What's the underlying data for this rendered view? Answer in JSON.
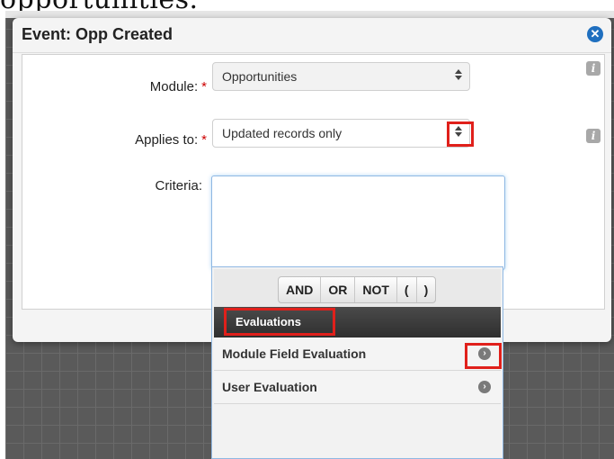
{
  "caption": "opportunities.",
  "modal": {
    "title": "Event: Opp Created",
    "close_icon": "close-circle-icon"
  },
  "form": {
    "module": {
      "label": "Module:",
      "value": "Opportunities",
      "required": true
    },
    "applies_to": {
      "label": "Applies to:",
      "value": "Updated records only",
      "required": true
    },
    "criteria": {
      "label": "Criteria:"
    },
    "info_icon": "info-icon",
    "required_marker": "*"
  },
  "criteria_dropdown": {
    "operators": [
      "AND",
      "OR",
      "NOT",
      "(",
      ")"
    ],
    "section_title": "Evaluations",
    "items": [
      {
        "label": "Module Field Evaluation",
        "icon": "arrow-right-circle-icon"
      },
      {
        "label": "User Evaluation",
        "icon": "arrow-right-circle-icon"
      }
    ]
  },
  "colors": {
    "highlight": "#e0201b",
    "close_button": "#1f6fbf",
    "required": "#cc0000"
  }
}
